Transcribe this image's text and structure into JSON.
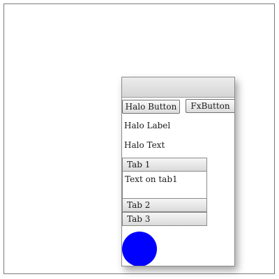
{
  "buttons": {
    "halo": "Halo Button",
    "fx": "FxButton"
  },
  "labels": {
    "halo_label": "Halo Label",
    "halo_text": "Halo Text"
  },
  "tabs": [
    {
      "label": "Tab 1",
      "content": "Text on tab1",
      "expanded": true
    },
    {
      "label": "Tab 2",
      "expanded": false
    },
    {
      "label": "Tab 3",
      "expanded": false
    }
  ],
  "colors": {
    "circle": "#0000ff"
  }
}
